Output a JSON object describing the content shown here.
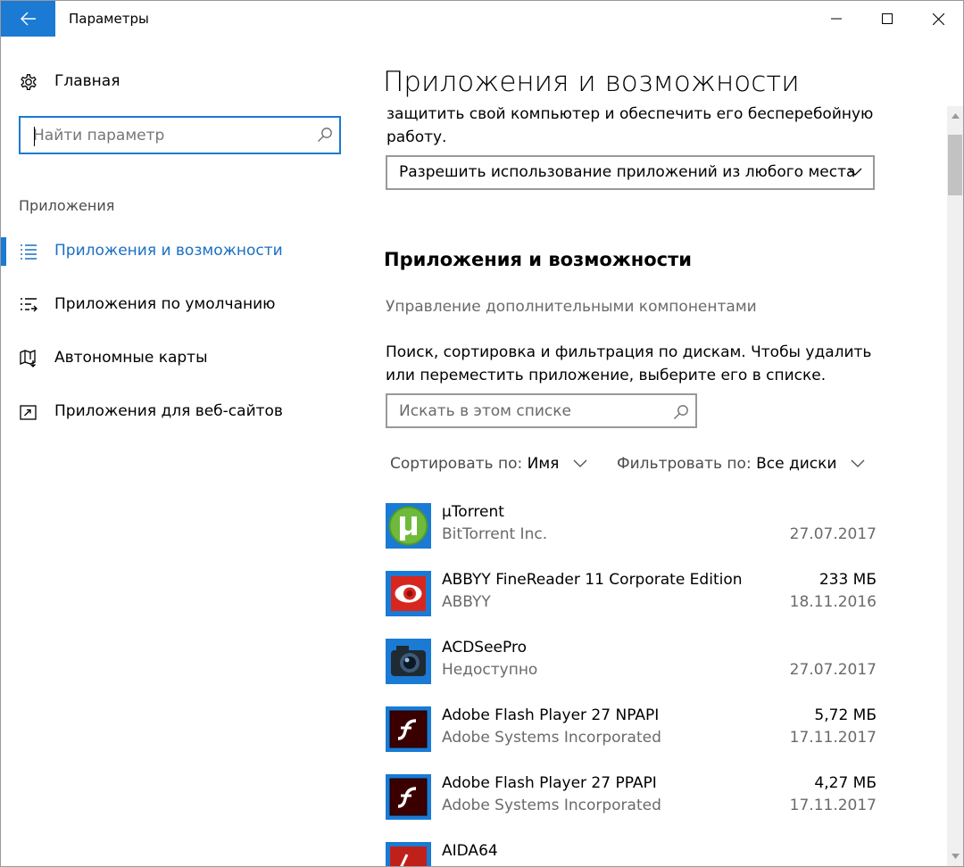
{
  "window": {
    "title": "Параметры"
  },
  "sidebar": {
    "home_label": "Главная",
    "search_placeholder": "Найти параметр",
    "section_label": "Приложения",
    "items": [
      {
        "label": "Приложения и возможности",
        "icon": "list-icon",
        "active": true
      },
      {
        "label": "Приложения по умолчанию",
        "icon": "default-apps-icon",
        "active": false
      },
      {
        "label": "Автономные карты",
        "icon": "map-icon",
        "active": false
      },
      {
        "label": "Приложения для веб-сайтов",
        "icon": "web-link-icon",
        "active": false
      }
    ]
  },
  "main": {
    "title": "Приложения и возможности",
    "intro_text": "защитить свой компьютер и обеспечить его бесперебойную работу.",
    "install_dropdown": "Разрешить использование приложений из любого места",
    "section_title": "Приложения и возможности",
    "optional_features_link": "Управление дополнительными компонентами",
    "search_hint": "Поиск, сортировка и фильтрация по дискам. Чтобы удалить или переместить приложение, выберите его в списке.",
    "list_search_placeholder": "Искать в этом списке",
    "sort_label": "Сортировать по:",
    "sort_value": "Имя",
    "filter_label": "Фильтровать по:",
    "filter_value": "Все диски",
    "apps": [
      {
        "name": "µTorrent",
        "publisher": "BitTorrent Inc.",
        "size": "",
        "date": "27.07.2017",
        "icon": "utorrent-icon"
      },
      {
        "name": "ABBYY FineReader 11 Corporate Edition",
        "publisher": "ABBYY",
        "size": "233 МБ",
        "date": "18.11.2016",
        "icon": "abbyy-icon"
      },
      {
        "name": "ACDSeePro",
        "publisher": "Недоступно",
        "size": "",
        "date": "27.07.2017",
        "icon": "acdsee-icon"
      },
      {
        "name": "Adobe Flash Player 27 NPAPI",
        "publisher": "Adobe Systems Incorporated",
        "size": "5,72 МБ",
        "date": "17.11.2017",
        "icon": "flash-icon"
      },
      {
        "name": "Adobe Flash Player 27 PPAPI",
        "publisher": "Adobe Systems Incorporated",
        "size": "4,27 МБ",
        "date": "17.11.2017",
        "icon": "flash-icon"
      },
      {
        "name": "AIDA64",
        "publisher": "",
        "size": "",
        "date": "",
        "icon": "aida64-icon"
      }
    ]
  },
  "colors": {
    "accent": "#1a7ad4",
    "secondary_text": "#6a6a6a"
  }
}
